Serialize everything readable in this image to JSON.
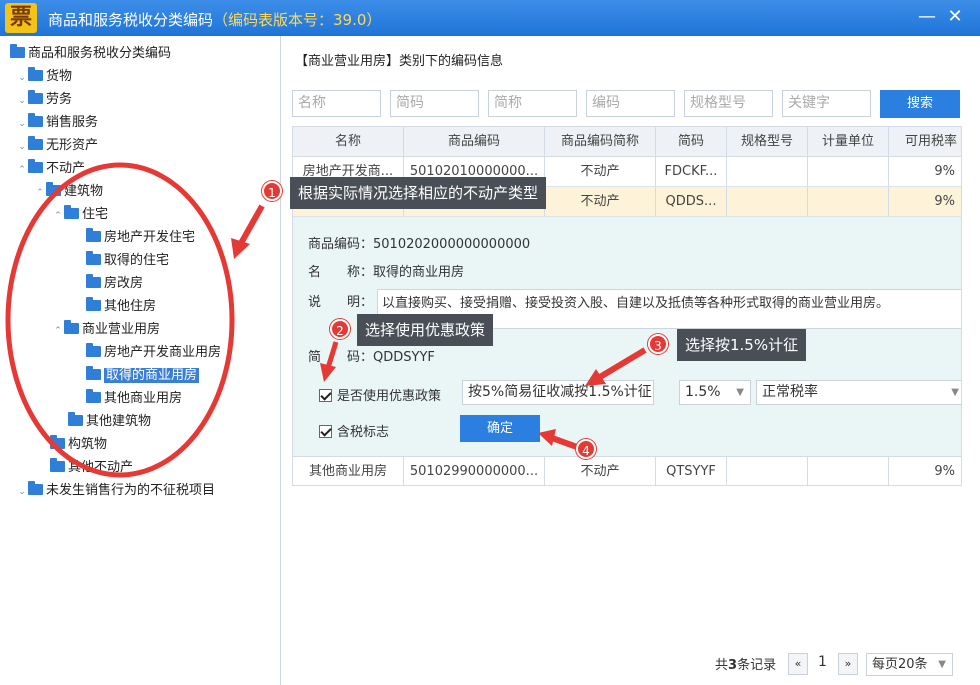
{
  "window": {
    "logo_char": "票",
    "title": "商品和服务税收分类编码",
    "version": "（编码表版本号：39.0）",
    "minimize": "—",
    "close": "✕"
  },
  "tree": {
    "root": "商品和服务税收分类编码",
    "goods": "货物",
    "labor": "劳务",
    "sales_service": "销售服务",
    "intangible": "无形资产",
    "real_estate": "不动产",
    "buildings": "建筑物",
    "residential": "住宅",
    "res_dev": "房地产开发住宅",
    "res_acquired": "取得的住宅",
    "res_reform": "房改房",
    "res_other": "其他住房",
    "commercial": "商业营业用房",
    "com_dev": "房地产开发商业用房",
    "com_acquired": "取得的商业用房",
    "com_other": "其他商业用房",
    "other_buildings": "其他建筑物",
    "structures": "构筑物",
    "other_real_estate": "其他不动产",
    "non_taxable": "未发生销售行为的不征税项目"
  },
  "main": {
    "section_title": "【商业营业用房】类别下的编码信息",
    "search": {
      "name_ph": "名称",
      "short_code_ph": "简码",
      "abbr_ph": "简称",
      "code_ph": "编码",
      "spec_ph": "规格型号",
      "keyword_ph": "关键字",
      "button": "搜索"
    },
    "columns": [
      "名称",
      "商品编码",
      "商品编码简称",
      "简码",
      "规格型号",
      "计量单位",
      "可用税率"
    ],
    "rows": [
      {
        "name": "房地产开发商...",
        "code": "50102010000000...",
        "abbr": "不动产",
        "short": "FDCKF...",
        "spec": "",
        "unit": "",
        "rate": "9%"
      },
      {
        "name": "取得的商业用房",
        "code": "50102020000000...",
        "abbr": "不动产",
        "short": "QDDS...",
        "spec": "",
        "unit": "",
        "rate": "9%"
      },
      {
        "name": "其他商业用房",
        "code": "50102990000000...",
        "abbr": "不动产",
        "short": "QTSYYF",
        "spec": "",
        "unit": "",
        "rate": "9%"
      }
    ],
    "detail": {
      "code_label": "商品编码：",
      "code_value": "5010202000000000000",
      "name_label": "名　　称：",
      "name_value": "取得的商业用房",
      "desc_label": "说　　明：",
      "desc_value": "以直接购买、接受捐赠、接受投资入股、自建以及抵债等各种形式取得的商业营业用房。",
      "short_label": "简　　码：",
      "short_value": "QDDSYYF",
      "preferential_label": "是否使用优惠政策",
      "preferential_value": "按5%简易征收减按1.5%计征",
      "rate_value": "1.5%",
      "rate_type_value": "正常税率",
      "tax_included_label": "含税标志",
      "confirm": "确定"
    },
    "pager": {
      "total_prefix": "共",
      "total_count": "3",
      "total_suffix": "条记录",
      "prev": "«",
      "page": "1",
      "next": "»",
      "per_page": "每页20条"
    }
  },
  "annotations": [
    {
      "num": "1",
      "text": "根据实际情况选择相应的不动产类型"
    },
    {
      "num": "2",
      "text": "选择使用优惠政策"
    },
    {
      "num": "3",
      "text": "选择按1.5%计征"
    },
    {
      "num": "4",
      "text": ""
    }
  ],
  "colors": {
    "accent": "#2a7fe0",
    "title_bar": "#1e74d8",
    "highlight_row": "#fdf3d8",
    "detail_bg": "#e9f6f5",
    "annotation_red": "#e53935"
  }
}
